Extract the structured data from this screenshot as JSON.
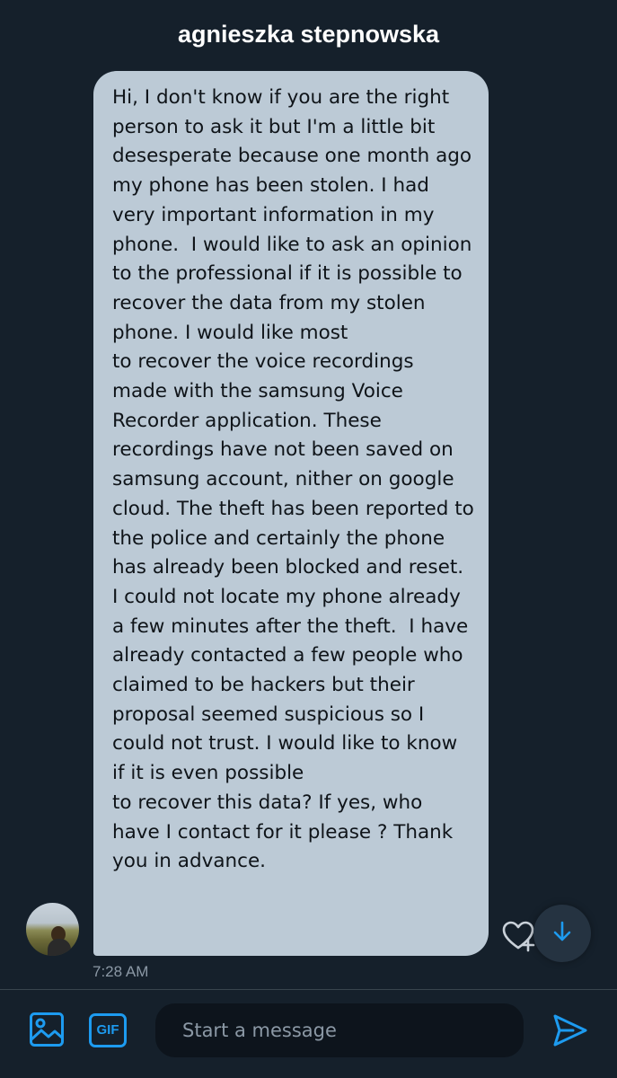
{
  "header": {
    "title": "agnieszka stepnowska"
  },
  "message": {
    "text": "Hi, I don't know if you are the right person to ask it but I'm a little bit desesperate because one month ago my phone has been stolen. I had very important information in my phone.  I would like to ask an opinion to the professional if it is possible to recover the data from my stolen phone. I would like most\nto recover the voice recordings made with the samsung Voice Recorder application. These recordings have not been saved on samsung account, nither on google cloud. The theft has been reported to the police and certainly the phone has already been blocked and reset. I could not locate my phone already a few minutes after the theft.  I have already contacted a few people who claimed to be hackers but their proposal seemed suspicious so I could not trust. I would like to know if it is even possible\nto recover this data? If yes, who have I contact for it please ? Thank you in advance.",
    "timestamp": "7:28 AM",
    "bubble_color": "#bccad6"
  },
  "composer": {
    "gif_label": "GIF",
    "placeholder": "Start a message",
    "value": ""
  },
  "icons": {
    "media": "image-icon",
    "gif": "gif-icon",
    "send": "send-icon",
    "react": "heart-icon",
    "scroll": "arrow-down-icon"
  },
  "colors": {
    "background": "#15202b",
    "accent": "#1d9bf0",
    "muted": "#8b98a5",
    "input_bg": "#0d141c"
  }
}
